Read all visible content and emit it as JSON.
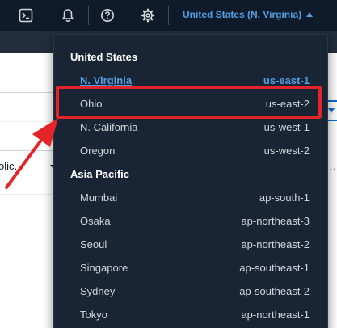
{
  "nav": {
    "icons": [
      "cloudshell-icon",
      "bell-icon",
      "help-icon",
      "gear-icon"
    ],
    "region_label": "United States (N. Virginia)"
  },
  "background": {
    "cut_text": "olic...",
    "more_dots": "..."
  },
  "dropdown": {
    "groups": [
      {
        "title": "United States",
        "regions": [
          {
            "name": "N. Virginia",
            "code": "us-east-1",
            "selected": true
          },
          {
            "name": "Ohio",
            "code": "us-east-2",
            "selected": false
          },
          {
            "name": "N. California",
            "code": "us-west-1",
            "selected": false
          },
          {
            "name": "Oregon",
            "code": "us-west-2",
            "selected": false
          }
        ]
      },
      {
        "title": "Asia Pacific",
        "regions": [
          {
            "name": "Mumbai",
            "code": "ap-south-1",
            "selected": false
          },
          {
            "name": "Osaka",
            "code": "ap-northeast-3",
            "selected": false
          },
          {
            "name": "Seoul",
            "code": "ap-northeast-2",
            "selected": false
          },
          {
            "name": "Singapore",
            "code": "ap-southeast-1",
            "selected": false
          },
          {
            "name": "Sydney",
            "code": "ap-southeast-2",
            "selected": false
          },
          {
            "name": "Tokyo",
            "code": "ap-northeast-1",
            "selected": false
          }
        ]
      }
    ]
  },
  "colors": {
    "nav_bg": "#0f1b2a",
    "dropdown_bg": "#192534",
    "accent_blue": "#539fe5",
    "highlight_red": "#e5242a"
  }
}
